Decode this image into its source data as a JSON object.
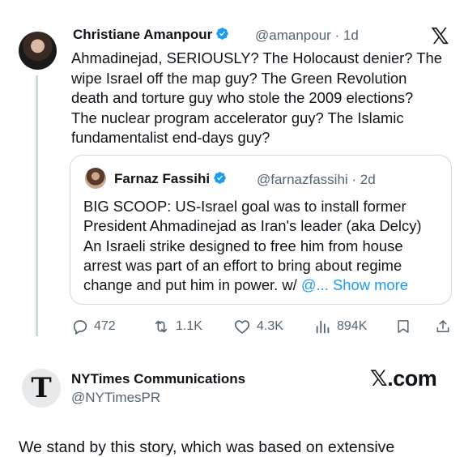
{
  "tweet1": {
    "author_name": "Christiane Amanpour",
    "handle_time": "@amanpour · 1d",
    "platform_logo": "𝕏",
    "body": "Ahmadinejad, SERIOUSLY? The Holocaust denier? The\nwipe Israel off the map guy? The Green Revolution\ndeath and torture guy who stole the 2009 elections?\nThe nuclear program accelerator guy? The Islamic\nfundamentalist end-days guy?"
  },
  "quote": {
    "author_name": "Farnaz Fassihi",
    "handle_time": "@farnazfassihi · 2d",
    "body": "BIG SCOOP: US-Israel goal was to install former\nPresident Ahmadinejad as Iran's leader (aka Delcy)\nAn Israeli strike designed to free him from house\narrest was part of an effort to bring about regime\nchange and put him in power. w/ ",
    "show_more": "@... Show more"
  },
  "actions": {
    "replies": "472",
    "reposts": "1.1K",
    "likes": "4.3K",
    "views": "894K"
  },
  "tweet2": {
    "avatar_letter": "T",
    "author_name": "NYTimes Communications",
    "handle": "@NYTimesPR",
    "watermark": "𝕏.com",
    "body_partial": "We stand by this story, which was based on extensive"
  },
  "colors": {
    "verified": "#1d9bf0",
    "link": "#1d9bf0",
    "secondary_text": "#536471",
    "border": "#cfd9de"
  }
}
